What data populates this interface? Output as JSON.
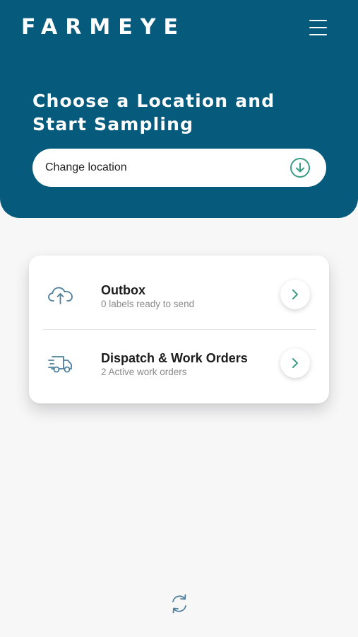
{
  "header": {
    "logo": "FARMEYE",
    "headline": "Choose a Location and Start Sampling",
    "menu_icon": "hamburger-menu-icon"
  },
  "location": {
    "label": "Change location",
    "icon": "download-circle-icon"
  },
  "card": {
    "rows": [
      {
        "title": "Outbox",
        "subtitle": "0 labels ready to send",
        "icon": "cloud-upload-icon"
      },
      {
        "title": "Dispatch & Work Orders",
        "subtitle": "2 Active work orders",
        "icon": "delivery-truck-icon"
      }
    ]
  },
  "footer": {
    "refresh_icon": "refresh-icon"
  },
  "colors": {
    "primary": "#065a7c",
    "accent": "#3a9c86",
    "background": "#f7f7f8",
    "icon": "#4d7f9c"
  }
}
